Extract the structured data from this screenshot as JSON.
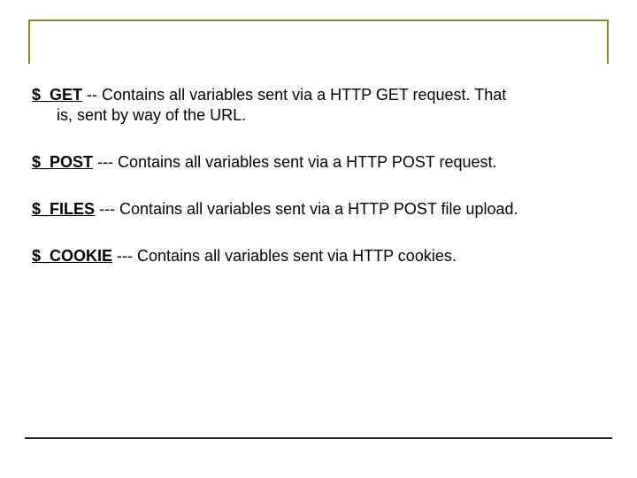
{
  "entries": [
    {
      "var": "$_GET",
      "sep": "  --  ",
      "desc": "Contains all variables sent via a HTTP GET request. That",
      "cont": "is, sent by way of the URL."
    },
    {
      "var": "$_POST",
      "sep": "   ---  ",
      "desc": "Contains all variables sent via a HTTP POST request.",
      "cont": ""
    },
    {
      "var": "$_FILES",
      "sep": "  ---  ",
      "desc": "Contains all variables sent via a HTTP POST file upload.",
      "cont": ""
    },
    {
      "var": "$_COOKIE",
      "sep": " ---  ",
      "desc": "Contains all variables sent via HTTP cookies.",
      "cont": ""
    }
  ]
}
